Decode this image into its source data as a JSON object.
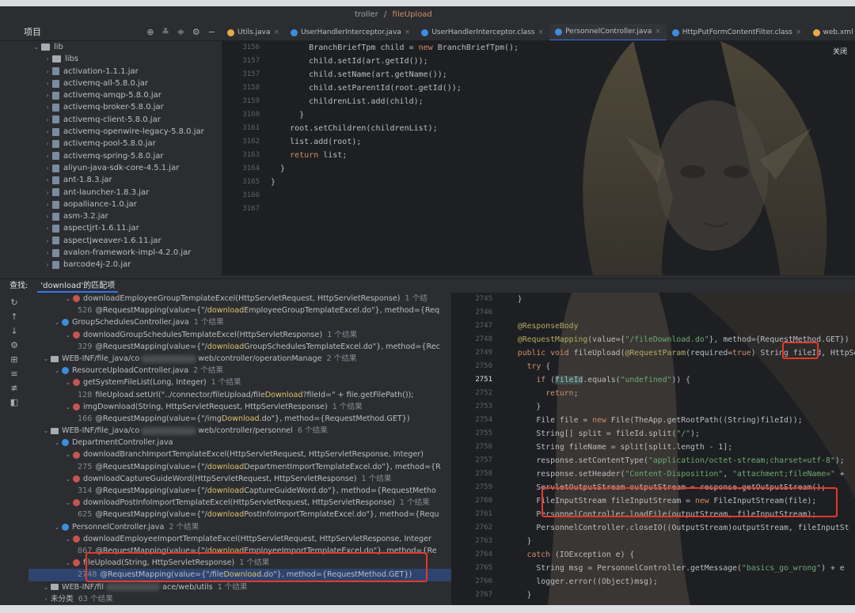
{
  "breadcrumb": {
    "prefix": "troller",
    "sep": "/",
    "file": "fileUpload"
  },
  "project": {
    "title": "项目"
  },
  "tabs": [
    {
      "label": "Utils.java",
      "color": "#e8a94a"
    },
    {
      "label": "UserHandlerInterceptor.java",
      "color": "#3c8dde"
    },
    {
      "label": "UserHandlerInterceptor.class",
      "color": "#3c8dde"
    },
    {
      "label": "PersonnelController.java",
      "color": "#3c8dde",
      "active": true
    },
    {
      "label": "HttpPutFormContentFilter.class",
      "color": "#3c8dde"
    },
    {
      "label": "web.xml",
      "color": "#e8a94a"
    }
  ],
  "close_label": "关闭",
  "tree": {
    "items": [
      {
        "label": "lib",
        "type": "folder",
        "arrow": "⌄",
        "indent": 40
      },
      {
        "label": "libs",
        "type": "folder",
        "arrow": "›",
        "indent": 54
      },
      {
        "label": "activation-1.1.1.jar",
        "type": "jar",
        "arrow": "›",
        "indent": 54
      },
      {
        "label": "activemq-all-5.8.0.jar",
        "type": "jar",
        "arrow": "›",
        "indent": 54
      },
      {
        "label": "activemq-amqp-5.8.0.jar",
        "type": "jar",
        "arrow": "›",
        "indent": 54
      },
      {
        "label": "activemq-broker-5.8.0.jar",
        "type": "jar",
        "arrow": "›",
        "indent": 54
      },
      {
        "label": "activemq-client-5.8.0.jar",
        "type": "jar",
        "arrow": "›",
        "indent": 54
      },
      {
        "label": "activemq-openwire-legacy-5.8.0.jar",
        "type": "jar",
        "arrow": "›",
        "indent": 54
      },
      {
        "label": "activemq-pool-5.8.0.jar",
        "type": "jar",
        "arrow": "›",
        "indent": 54
      },
      {
        "label": "activemq-spring-5.8.0.jar",
        "type": "jar",
        "arrow": "›",
        "indent": 54
      },
      {
        "label": "aliyun-java-sdk-core-4.5.1.jar",
        "type": "jar",
        "arrow": "›",
        "indent": 54
      },
      {
        "label": "ant-1.8.3.jar",
        "type": "jar",
        "arrow": "›",
        "indent": 54
      },
      {
        "label": "ant-launcher-1.8.3.jar",
        "type": "jar",
        "arrow": "›",
        "indent": 54
      },
      {
        "label": "aopalliance-1.0.jar",
        "type": "jar",
        "arrow": "›",
        "indent": 54
      },
      {
        "label": "asm-3.2.jar",
        "type": "jar",
        "arrow": "›",
        "indent": 54
      },
      {
        "label": "aspectjrt-1.6.11.jar",
        "type": "jar",
        "arrow": "›",
        "indent": 54
      },
      {
        "label": "aspectjweaver-1.6.11.jar",
        "type": "jar",
        "arrow": "›",
        "indent": 54
      },
      {
        "label": "avalon-framework-impl-4.2.0.jar",
        "type": "jar",
        "arrow": "›",
        "indent": 54
      },
      {
        "label": "barcode4j-2.0.jar",
        "type": "jar",
        "arrow": "›",
        "indent": 54
      }
    ]
  },
  "code_top": {
    "lines": [
      {
        "n": "3156",
        "t": "        BranchBriefTpm child = new BranchBriefTpm();"
      },
      {
        "n": "3157",
        "t": "        child.setId(art.getId());"
      },
      {
        "n": "3157",
        "t": "        child.setName(art.getName());"
      },
      {
        "n": "3158",
        "t": "        child.setParentId(root.getId());"
      },
      {
        "n": "3159",
        "t": "        childrenList.add(child);"
      },
      {
        "n": "3160",
        "t": "      }"
      },
      {
        "n": "3161",
        "t": "    root.setChildren(childrenList);"
      },
      {
        "n": "3162",
        "t": "    list.add(root);"
      },
      {
        "n": "3163",
        "t": "    return list;"
      },
      {
        "n": "3164",
        "t": "  }"
      },
      {
        "n": "3165",
        "t": "}"
      },
      {
        "n": "3166",
        "t": ""
      },
      {
        "n": "3167",
        "t": ""
      }
    ]
  },
  "search": {
    "title": "查找:",
    "query": "'download'的匹配项"
  },
  "results": [
    {
      "kind": "method",
      "indent": 44,
      "pre": "downloadEmployeeGroupTemplateExcel(HttpServletRequest, HttpServletResponse)",
      "cnt": "1 个结"
    },
    {
      "kind": "code",
      "indent": 62,
      "ln": "526",
      "a": "@RequestMapping(value={\"/",
      "h": "download",
      "b": "EmployeeGroupTemplateExcel.do\"}, method={Req"
    },
    {
      "kind": "class",
      "indent": 30,
      "pre": "GroupSchedulesController.java",
      "cnt": "1 个结果"
    },
    {
      "kind": "method",
      "indent": 44,
      "pre": "downloadGroupSchedulesTemplateExcel(HttpServletResponse)",
      "cnt": "1 个结果"
    },
    {
      "kind": "code",
      "indent": 62,
      "ln": "329",
      "a": "@RequestMapping(value={\"/",
      "h": "download",
      "b": "GroupSchedulesTemplateExcel.do\"}, method={Rec"
    },
    {
      "kind": "folder",
      "indent": 16,
      "pre": "WEB-INF/file_java/co",
      "blur": true,
      "post": "web/controller/operationManage",
      "cnt": "2 个结果"
    },
    {
      "kind": "class",
      "indent": 30,
      "pre": "ResourceUploadController.java",
      "cnt": "2 个结果"
    },
    {
      "kind": "method",
      "indent": 44,
      "pre": "getSystemFileList(Long, Integer)",
      "cnt": "1 个结果"
    },
    {
      "kind": "code",
      "indent": 62,
      "ln": "128",
      "a": "fileUpload.setUrl(\"../connector/fileUpload/file",
      "h": "Download",
      "b": "?fileId=\" + file.getFilePath());"
    },
    {
      "kind": "method",
      "indent": 44,
      "pre": "imgDownload(String, HttpServletRequest, HttpServletResponse)",
      "cnt": "1 个结果"
    },
    {
      "kind": "code",
      "indent": 62,
      "ln": "166",
      "a": "@RequestMapping(value={\"/img",
      "h": "Download",
      "b": ".do\"}, method={RequestMethod.GET})"
    },
    {
      "kind": "folder",
      "indent": 16,
      "pre": "WEB-INF/file_java/co",
      "blur": true,
      "post": "web/controller/personnel",
      "cnt": "6 个结果"
    },
    {
      "kind": "class",
      "indent": 30,
      "pre": "DepartmentController.java",
      "cnt": ""
    },
    {
      "kind": "method",
      "indent": 44,
      "pre": "downloadBranchImportTemplateExcel(HttpServletRequest, HttpServletResponse, Integer)",
      "cnt": ""
    },
    {
      "kind": "code",
      "indent": 62,
      "ln": "275",
      "a": "@RequestMapping(value={\"/",
      "h": "download",
      "b": "DepartmentImportTemplateExcel.do\"}, method={R"
    },
    {
      "kind": "method",
      "indent": 44,
      "pre": "downloadCaptureGuideWord(HttpServletRequest, HttpServletResponse)",
      "cnt": "1 个结果"
    },
    {
      "kind": "code",
      "indent": 62,
      "ln": "314",
      "a": "@RequestMapping(value={\"/",
      "h": "download",
      "b": "CaptureGuideWord.do\"}, method={RequestMetho"
    },
    {
      "kind": "method",
      "indent": 44,
      "pre": "downloadPostInfoImportTemplateExcel(HttpServletRequest, HttpServletResponse)",
      "cnt": "1 个结果"
    },
    {
      "kind": "code",
      "indent": 62,
      "ln": "625",
      "a": "@RequestMapping(value={\"/",
      "h": "download",
      "b": "PostInfoImportTemplateExcel.do\"}, method={Requ"
    },
    {
      "kind": "class",
      "indent": 30,
      "pre": "PersonnelController.java",
      "cnt": "2 个结果"
    },
    {
      "kind": "method",
      "indent": 44,
      "pre": "downloadEmployeeImportTemplateExcel(HttpServletRequest, HttpServletResponse, Integer",
      "cnt": ""
    },
    {
      "kind": "code",
      "indent": 62,
      "ln": "867",
      "a": "@RequestMapping(value={\"/",
      "h": "download",
      "b": "EmployeeImportTemplateExcel.do\"}, method={Re"
    },
    {
      "kind": "method",
      "indent": 44,
      "pre": "fileUpload(String, HttpServletResponse)",
      "cnt": "1 个结果"
    },
    {
      "kind": "code",
      "indent": 62,
      "ln": "2748",
      "a": "@RequestMapping(value={\"/file",
      "h": "Download",
      "b": ".do\"}, method={RequestMethod.GET})",
      "selected": true
    },
    {
      "kind": "folder",
      "indent": 16,
      "pre": "WEB-INF/fil",
      "blur": true,
      "post": "ace/web/utils",
      "cnt": "1 个结果"
    },
    {
      "kind": "plain",
      "indent": 16,
      "pre": "未分类",
      "cnt": "63 个结果"
    }
  ],
  "code_bottom": {
    "lines": [
      {
        "n": "2745",
        "t": "  }"
      },
      {
        "n": "2746",
        "t": ""
      },
      {
        "n": "2747",
        "t": "  @ResponseBody"
      },
      {
        "n": "2748",
        "t": "  @RequestMapping(value={\"/fileDownload.do\"}, method={RequestMethod.GET})"
      },
      {
        "n": "2749",
        "t": "  public void fileUpload(@RequestParam(required=true) String fileId, HttpSer"
      },
      {
        "n": "2750",
        "t": "    try {"
      },
      {
        "n": "2751",
        "t": "      if (fileId.equals(\"undefined\")) {"
      },
      {
        "n": "2752",
        "t": "        return;"
      },
      {
        "n": "2753",
        "t": "      }"
      },
      {
        "n": "2754",
        "t": "      File file = new File(TheApp.getRootPath((String)fileId));"
      },
      {
        "n": "2755",
        "t": "      String[] split = fileId.split(\"/\");"
      },
      {
        "n": "2756",
        "t": "      String fileName = split[split.length - 1];"
      },
      {
        "n": "2757",
        "t": "      response.setContentType(\"application/octet-stream;charset=utf-8\");"
      },
      {
        "n": "2758",
        "t": "      response.setHeader(\"Content-Disposition\", \"attachment;fileName=\" +"
      },
      {
        "n": "2759",
        "t": "      ServletOutputStream outputStream = response.getOutputStream();"
      },
      {
        "n": "2760",
        "t": "      FileInputStream fileInputStream = new FileInputStream(file);"
      },
      {
        "n": "2761",
        "t": "      PersonnelController.loadFile(outputStream, fileInputStream);"
      },
      {
        "n": "2762",
        "t": "      PersonnelController.closeIO((OutputStream)outputStream, fileInputSt"
      },
      {
        "n": "2763",
        "t": "    }"
      },
      {
        "n": "2764",
        "t": "    catch (IOException e) {"
      },
      {
        "n": "2765",
        "t": "      String msg = PersonnelController.getMessage(\"basics_go_wrong\") + e"
      },
      {
        "n": "2766",
        "t": "      logger.error((Object)msg);"
      },
      {
        "n": "2767",
        "t": "    }"
      }
    ]
  },
  "accent": "#e23a2c"
}
